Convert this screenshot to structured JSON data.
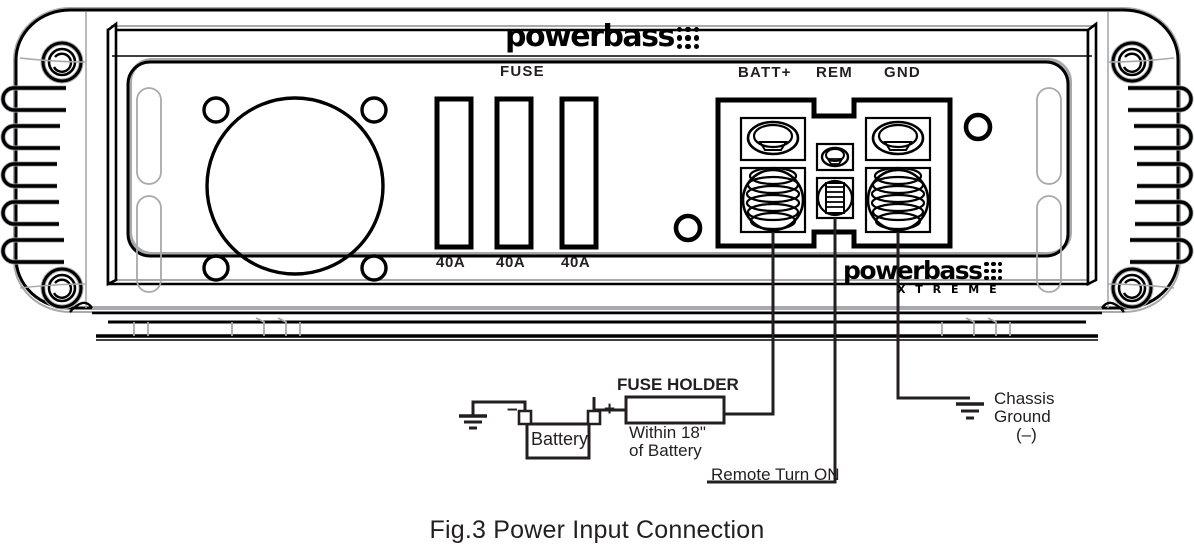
{
  "figure": {
    "caption": "Fig.3  Power Input Connection"
  },
  "amplifier": {
    "brand_logo": {
      "word": "powerbass",
      "dots_icon": "dot-grid-icon"
    },
    "secondary_logo": {
      "word": "powerbass",
      "sub": "X T R E M E",
      "dots_icon": "dot-grid-icon"
    },
    "fuse_section": {
      "heading": "FUSE",
      "slots": [
        {
          "rating": "40A"
        },
        {
          "rating": "40A"
        },
        {
          "rating": "40A"
        }
      ]
    },
    "terminal_block": {
      "terminals": [
        {
          "label": "BATT+",
          "type": "large"
        },
        {
          "label": "REM",
          "type": "small"
        },
        {
          "label": "GND",
          "type": "large"
        }
      ]
    }
  },
  "wiring": {
    "battery": {
      "label": "Battery",
      "negative_mark": "–",
      "positive_mark": "+"
    },
    "fuse_holder": {
      "label": "FUSE HOLDER",
      "note_line1": "Within 18\"",
      "note_line2": "of Battery"
    },
    "remote": {
      "label": "Remote Turn ON"
    },
    "chassis_ground": {
      "line1": "Chassis",
      "line2": "Ground",
      "line3": "(–)"
    }
  },
  "colors": {
    "ink": "#231f20",
    "line": "#000000",
    "shadow": "#a7a9ac",
    "paper": "#ffffff"
  }
}
